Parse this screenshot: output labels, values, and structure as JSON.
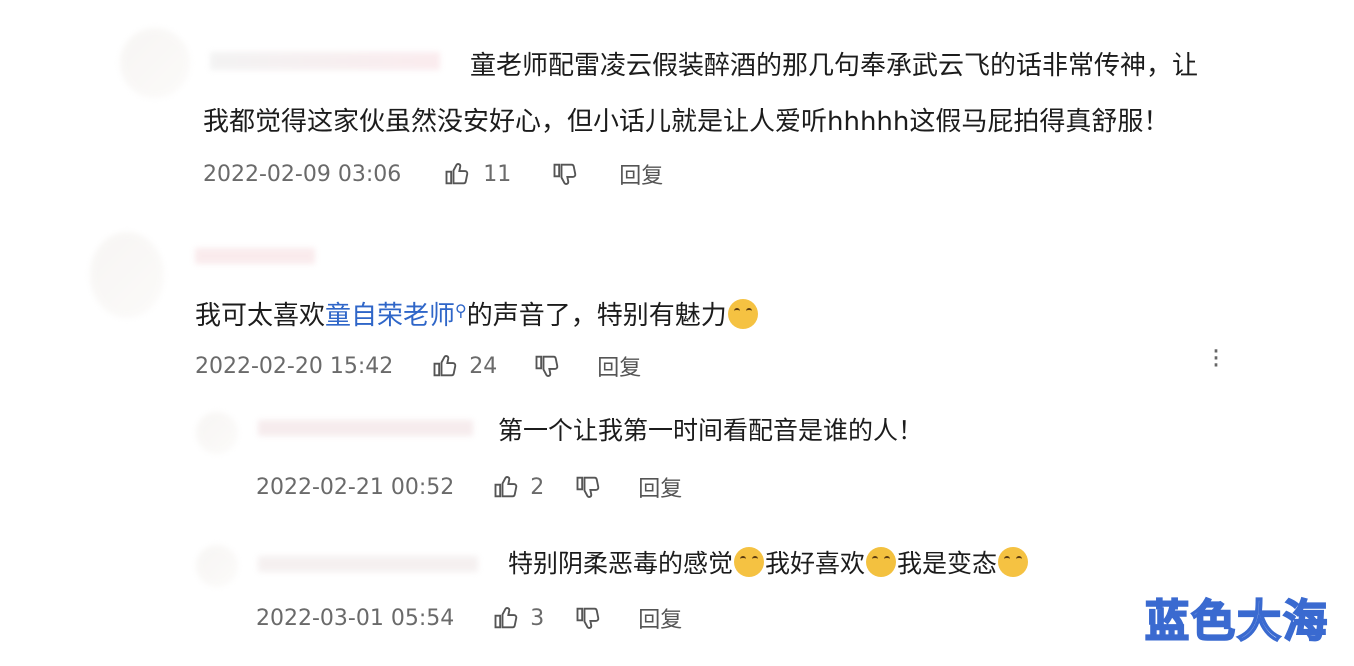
{
  "comments": [
    {
      "text": "童老师配雷凌云假装醉酒的那几句奉承武云飞的话非常传神，让",
      "text_line2": "我都觉得这家伙虽然没安好心，但小话儿就是让人爱听hhhhh这假马屁拍得真舒服！",
      "date": "2022-02-09 03:06",
      "likes": "11",
      "reply_label": "回复"
    },
    {
      "text_pre": "我可太喜欢",
      "mention": "童自荣老师",
      "text_post": "的声音了，特别有魅力",
      "date": "2022-02-20 15:42",
      "likes": "24",
      "reply_label": "回复",
      "replies": [
        {
          "text": "第一个让我第一时间看配音是谁的人！",
          "date": "2022-02-21 00:52",
          "likes": "2",
          "reply_label": "回复"
        },
        {
          "text_a": "特别阴柔恶毒的感觉",
          "text_b": "我好喜欢",
          "text_c": "我是变态",
          "date": "2022-03-01 05:54",
          "likes": "3",
          "reply_label": "回复"
        }
      ]
    }
  ],
  "watermark": "蓝色大海",
  "icons": {
    "like": "thumbs-up-icon",
    "dislike": "thumbs-down-icon",
    "more": "more-vertical-icon",
    "search": "search-icon"
  },
  "colors": {
    "link": "#2f66c8",
    "meta": "#6a6a6a",
    "watermark_stroke": "#3a6ad0"
  }
}
